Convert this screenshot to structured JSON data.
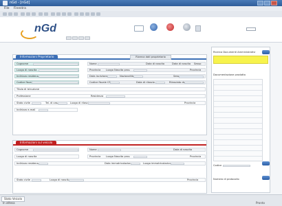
{
  "window": {
    "title": "nGd - [nGd]"
  },
  "menu": [
    "File",
    "Finestra"
  ],
  "app": {
    "logo": "nGd"
  },
  "section1": {
    "title": "Informazioni Proprietario",
    "extra": "Ricerca dati proprietario",
    "labels": {
      "cognome": "Cognome",
      "nome": "Nome",
      "data_nascita": "Data di nascita",
      "sesso": "Sesso",
      "luogo_nascita": "Luogo di nascita",
      "provincia": "Provincia",
      "luogo_nasc_prov": "Luogo Nascita prov.",
      "indirizzo": "Indirizzo residenza",
      "data_iscrizione": "Data iscrizione",
      "nazionalita": "Nazionalità",
      "sesso2": "Sesso",
      "codice_fiscale": "Codice fiscale",
      "codice_fiscale2": "Codice fiscale CF",
      "data_rilascio": "Data di rilascio",
      "rilasciato": "Rilasciato da",
      "titolo": "Titolo di istruzione",
      "professione": "Professione",
      "residenza": "Residenza",
      "stato_civile": "Stato civile",
      "tel": "Tel. di casa",
      "luogo_rilascio": "Luogo di rilascio",
      "provincia2": "Provincia",
      "indirizzo_mail": "Indirizzo e-mail"
    }
  },
  "section2": {
    "title": "Informazioni sul veicolo",
    "labels": {
      "cognome": "Cognome",
      "nome": "Nome",
      "data_nascita": "Data di nascita",
      "luogo_nascita": "Luogo di nascita",
      "provincia": "Provincia",
      "luogo_nasc_prov": "Luogo Nascita prov.",
      "provincia_b": "Provincia",
      "indirizzo": "Indirizzo residenza",
      "data_immatricolazione": "Data immatricolazione",
      "luogo_immatricolazione": "Luogo immatricolazione",
      "stato_civile": "Stato civile",
      "luogo_nascita2": "Luogo di nascita",
      "provincia2": "Provincia"
    }
  },
  "right_panel": {
    "title1": "Ricerca Documenti Amministrativi",
    "title2": "Documentazione prodotta",
    "field_a": "Codice",
    "field_b": "Numero di protocollo"
  },
  "status": {
    "tab": "Stato Veicolo",
    "left": "In attesa",
    "right": "Pronto"
  }
}
